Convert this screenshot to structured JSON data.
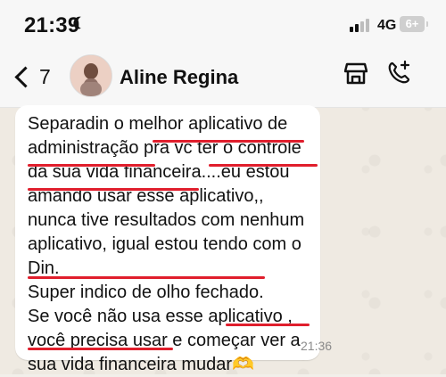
{
  "status_bar": {
    "time": "21:39",
    "network": "4G",
    "battery": "6+"
  },
  "header": {
    "back_count": "7",
    "contact_name": "Aline Regina"
  },
  "message": {
    "text": "Separadin  o melhor aplicativo de administração pra vc ter o controle da sua vida financeira....eu estou amando usar  esse aplicativo,, nunca tive resultados com nenhum aplicativo, igual estou tendo com o Din.\nSuper indico de olho fechado.\nSe você não usa esse aplicativo , você precisa usar e começar ver a sua vida financeira mudar🫶",
    "time": "21:36"
  },
  "theme": {
    "underline_color": "#e01e2c",
    "bubble_color": "#ffffff"
  }
}
